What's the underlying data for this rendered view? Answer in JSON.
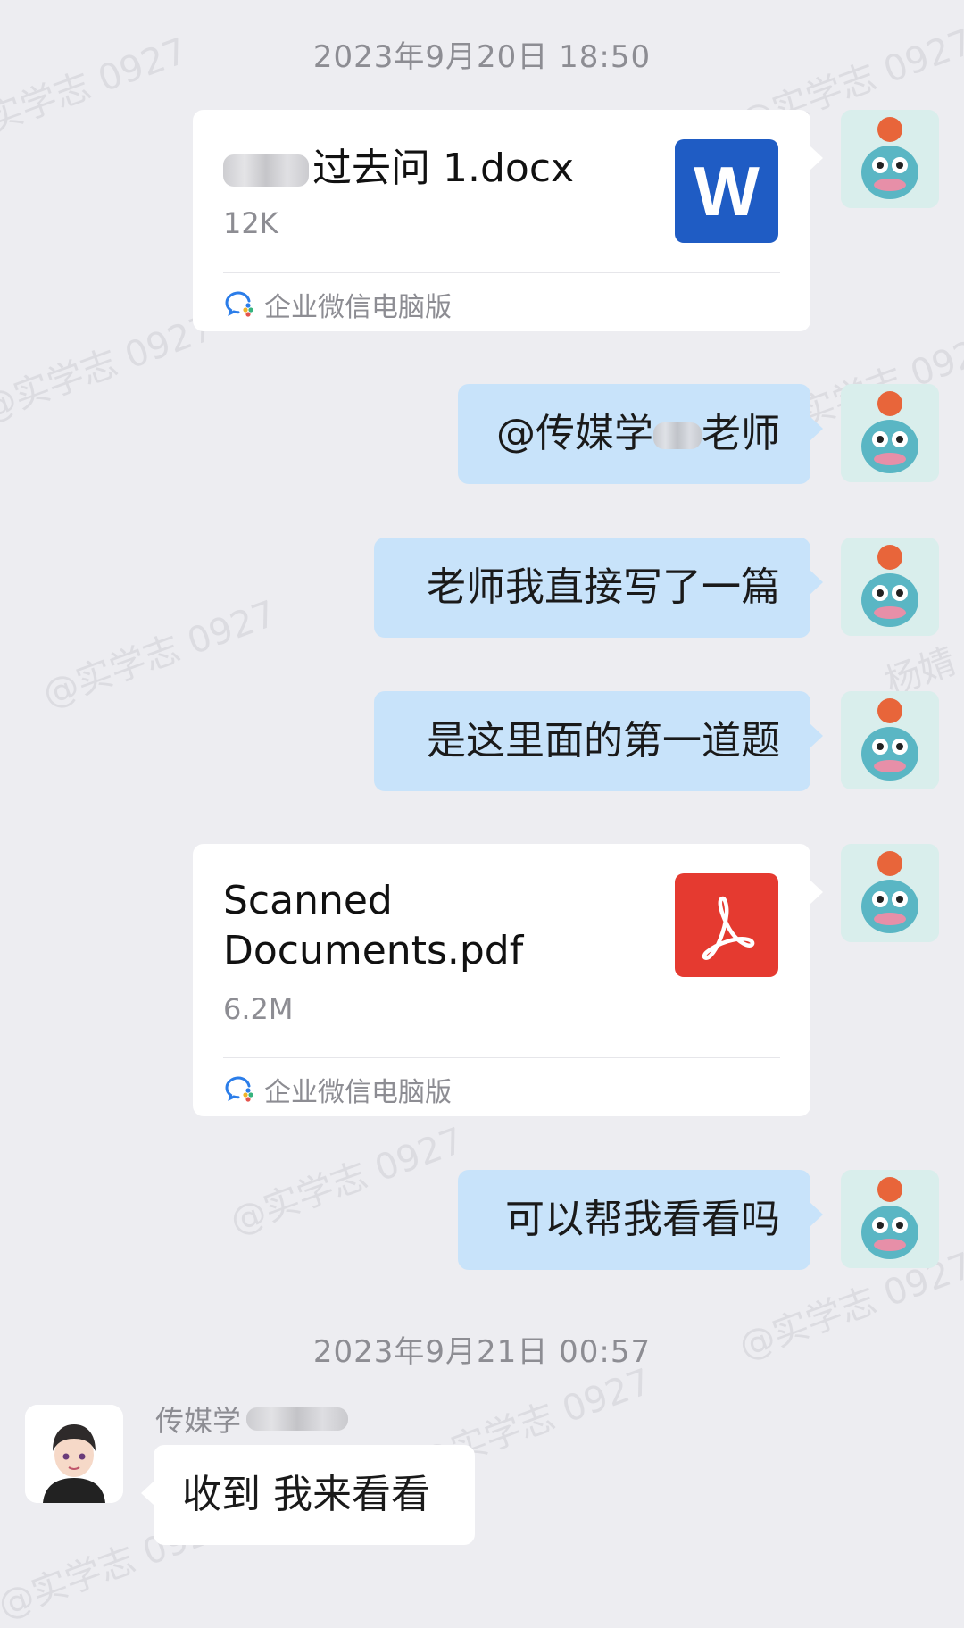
{
  "watermark_text": "@实学志 0927",
  "watermark_text_alt": "杨婧",
  "timestamps": [
    "2023年9月20日 18:50",
    "2023年9月21日 00:57"
  ],
  "messages": {
    "m1": {
      "file_name": "过去问 1.docx",
      "file_size": "12K",
      "source": "企业微信电脑版",
      "icon": "word-icon",
      "icon_letter": "W",
      "color": "#1f5cc4"
    },
    "m2": {
      "prefix": "@传媒学",
      "suffix": "老师"
    },
    "m3": {
      "text": "老师我直接写了一篇"
    },
    "m4": {
      "text": "是这里面的第一道题"
    },
    "m5": {
      "file_name_line1": "Scanned",
      "file_name_line2": "Documents.pdf",
      "file_size": "6.2M",
      "source": "企业微信电脑版",
      "icon": "pdf-icon",
      "color": "#e53a30"
    },
    "m6": {
      "text": "可以帮我看看吗"
    },
    "m7": {
      "sender": "传媒学",
      "text": "收到 我来看看"
    }
  },
  "colors": {
    "bubble_blue": "#c8e3fa",
    "background": "#ededf1"
  }
}
